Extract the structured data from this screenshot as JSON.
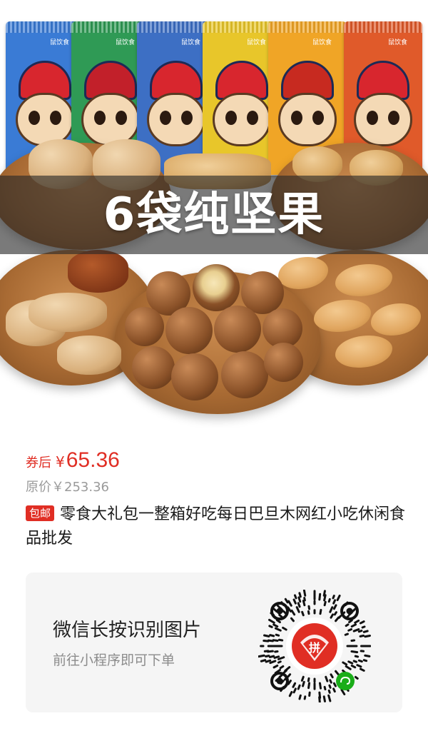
{
  "hero": {
    "banner_text": "6袋纯坚果",
    "bag_colors": [
      "#3a7bd5",
      "#2f9a55",
      "#3d6fc4",
      "#e8c62a",
      "#f0a526",
      "#e05a2a"
    ],
    "bag_label": "鼠饮食"
  },
  "price": {
    "label": "券后",
    "symbol": "¥",
    "value": "65.36",
    "color": "#e02e24"
  },
  "original_price": {
    "text": "原价￥253.36"
  },
  "product": {
    "badge": "包邮",
    "title": "零食大礼包一整箱好吃每日巴旦木网红小吃休闲食品批发"
  },
  "qr_card": {
    "main_text": "微信长按识别图片",
    "sub_text": "前往小程序即可下单",
    "logo_char": "拼",
    "logo_color": "#e02e24",
    "wechat_color": "#1aad19"
  }
}
